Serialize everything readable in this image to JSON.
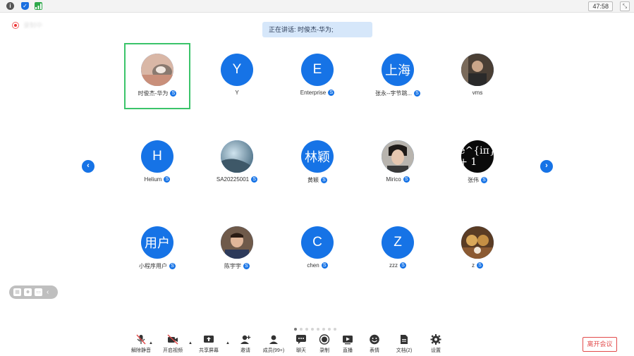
{
  "topbar": {
    "timer": "47:58"
  },
  "recording": {
    "label": "录制中"
  },
  "speaking": {
    "text": "正在讲话: 时俊杰-华为;"
  },
  "participants": [
    {
      "name": "时俊杰-华为",
      "avatar": "",
      "badge": "S"
    },
    {
      "name": "Y",
      "avatar": "Y",
      "badge": ""
    },
    {
      "name": "Enterprise",
      "avatar": "E",
      "badge": "S"
    },
    {
      "name": "张永--字节跳...",
      "avatar": "上海",
      "badge": "S"
    },
    {
      "name": "vms",
      "avatar": "",
      "badge": ""
    },
    {
      "name": "Helium",
      "avatar": "H",
      "badge": "S"
    },
    {
      "name": "SA20225001",
      "avatar": "",
      "badge": "S"
    },
    {
      "name": "黄颖",
      "avatar": "林颖",
      "badge": "S"
    },
    {
      "name": "Mirico",
      "avatar": "",
      "badge": "S"
    },
    {
      "name": "张伟",
      "avatar": "e^{iπ} + 1",
      "badge": "S"
    },
    {
      "name": "小程序用户",
      "avatar": "用户",
      "badge": "S"
    },
    {
      "name": "陈宇宇",
      "avatar": "",
      "badge": "S"
    },
    {
      "name": "chen",
      "avatar": "C",
      "badge": "S"
    },
    {
      "name": "zzz",
      "avatar": "Z",
      "badge": "S"
    },
    {
      "name": "z",
      "avatar": "",
      "badge": "S"
    }
  ],
  "toolbar": {
    "unmute": "解除静音",
    "start_video": "开启视频",
    "share_screen": "共享屏幕",
    "invite": "邀请",
    "members": "成员(99+)",
    "chat": "聊天",
    "record": "录制",
    "live": "直播",
    "reactions": "表情",
    "docs": "文档(2)",
    "settings": "设置"
  },
  "leave_button": "离开会议",
  "colors": {
    "accent": "#1673e6",
    "active_border": "#3bc46a",
    "leave": "#e24b4b"
  }
}
